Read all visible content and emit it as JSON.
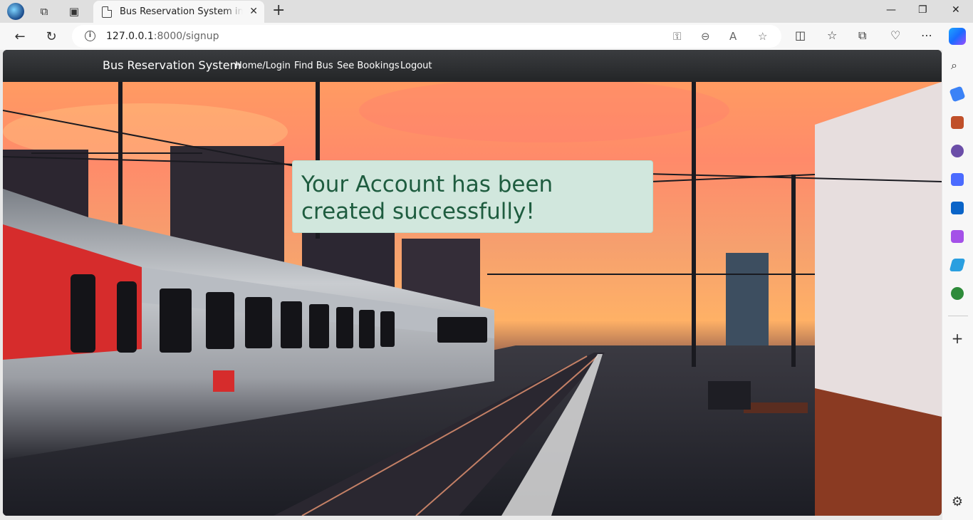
{
  "browser": {
    "tab_title": "Bus Reservation System in Django",
    "url_host": "127.0.0.1",
    "url_path": ":8000/signup",
    "new_tab_glyph": "+",
    "tab_close_glyph": "✕",
    "window_controls": {
      "minimize": "—",
      "restore": "❐",
      "close": "✕"
    }
  },
  "site": {
    "brand": "Bus Reservation System",
    "nav": [
      {
        "label": "Home/Login"
      },
      {
        "label": "Find Bus"
      },
      {
        "label": "See Bookings"
      },
      {
        "label": "Logout"
      }
    ]
  },
  "alert": {
    "message": "Your Account has been created successfully!",
    "background": "#d1e7dd",
    "text_color": "#1e5c3f"
  },
  "colors": {
    "navbar": "#2d2f31",
    "sky_top": "#ff9b62"
  },
  "icons": {
    "sidebar": [
      "search-icon",
      "tag-icon",
      "briefcase-icon",
      "games-icon",
      "copilot-app-icon",
      "outlook-icon",
      "designer-icon",
      "send-icon",
      "tree-icon",
      "add-icon",
      "settings-icon"
    ]
  }
}
